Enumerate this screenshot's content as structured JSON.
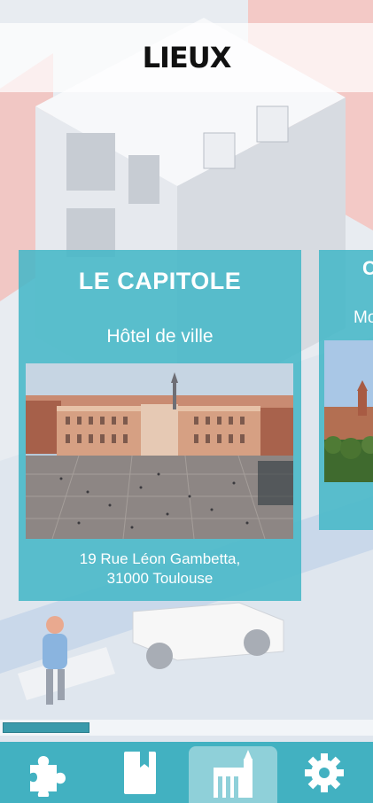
{
  "header": {
    "title": "LIEUX"
  },
  "cards": [
    {
      "title": "LE CAPITOLE",
      "subtitle": "Hôtel de ville",
      "address_line1": "19 Rue Léon Gambetta,",
      "address_line2": "31000 Toulouse"
    },
    {
      "title_partial": "C",
      "subtitle_partial": "Mo"
    }
  ],
  "tabs": [
    {
      "icon": "puzzle-icon",
      "active": false
    },
    {
      "icon": "book-icon",
      "active": false
    },
    {
      "icon": "monument-icon",
      "active": true
    },
    {
      "icon": "gear-icon",
      "active": false
    }
  ],
  "colors": {
    "accent": "#42b1c1",
    "card": "#45b7c7",
    "active_tab": "#8fd0d9"
  }
}
